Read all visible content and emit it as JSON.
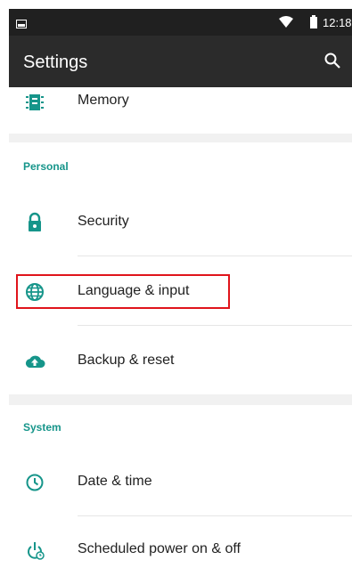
{
  "status_bar": {
    "time": "12:18",
    "icons": [
      "notification-icon",
      "wifi-icon",
      "battery-icon"
    ]
  },
  "app_bar": {
    "title": "Settings",
    "search_icon": "search-icon"
  },
  "top_item": {
    "label": "Memory",
    "icon": "memory-icon"
  },
  "sections": [
    {
      "header": "Personal",
      "items": [
        {
          "label": "Security",
          "icon": "lock-icon"
        },
        {
          "label": "Language & input",
          "icon": "globe-icon",
          "highlighted": true
        },
        {
          "label": "Backup & reset",
          "icon": "cloud-upload-icon"
        }
      ]
    },
    {
      "header": "System",
      "items": [
        {
          "label": "Date & time",
          "icon": "clock-icon"
        },
        {
          "label": "Scheduled power on & off",
          "icon": "power-schedule-icon"
        }
      ]
    }
  ],
  "colors": {
    "accent": "#16958a",
    "app_bar": "#2b2b2b",
    "status_bar": "#202020",
    "highlight_border": "#e0141b"
  }
}
